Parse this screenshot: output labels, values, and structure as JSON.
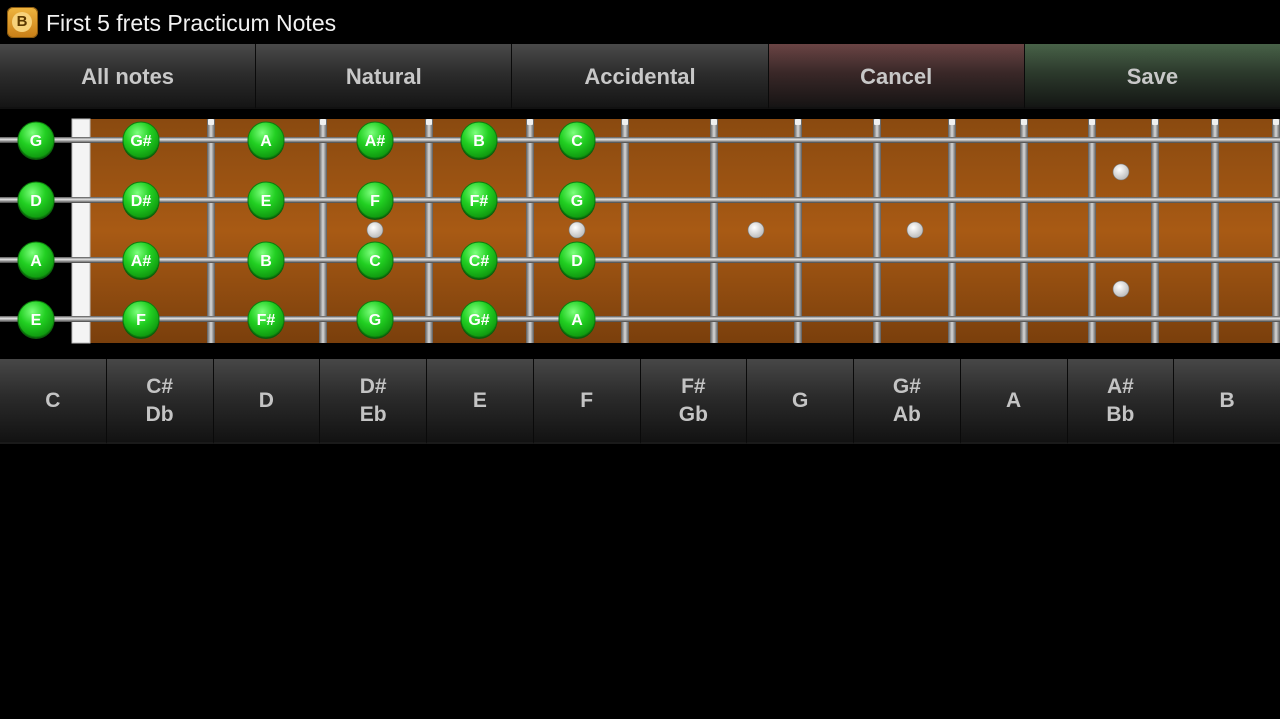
{
  "app": {
    "icon_letter": "B",
    "title": "First 5 frets Practicum Notes"
  },
  "toolbar": {
    "all_notes": "All notes",
    "natural": "Natural",
    "accidental": "Accidental",
    "cancel": "Cancel",
    "save": "Save"
  },
  "fretboard": {
    "strings": [
      {
        "open": "G",
        "frets": [
          "G#",
          "A",
          "A#",
          "B",
          "C"
        ]
      },
      {
        "open": "D",
        "frets": [
          "D#",
          "E",
          "F",
          "F#",
          "G"
        ]
      },
      {
        "open": "A",
        "frets": [
          "A#",
          "B",
          "C",
          "C#",
          "D"
        ]
      },
      {
        "open": "E",
        "frets": [
          "F",
          "F#",
          "G",
          "G#",
          "A"
        ]
      }
    ],
    "note_color": "#22cc22",
    "wood_color": "#a0520f"
  },
  "note_buttons": [
    {
      "line1": "C",
      "line2": ""
    },
    {
      "line1": "C#",
      "line2": "Db"
    },
    {
      "line1": "D",
      "line2": ""
    },
    {
      "line1": "D#",
      "line2": "Eb"
    },
    {
      "line1": "E",
      "line2": ""
    },
    {
      "line1": "F",
      "line2": ""
    },
    {
      "line1": "F#",
      "line2": "Gb"
    },
    {
      "line1": "G",
      "line2": ""
    },
    {
      "line1": "G#",
      "line2": "Ab"
    },
    {
      "line1": "A",
      "line2": ""
    },
    {
      "line1": "A#",
      "line2": "Bb"
    },
    {
      "line1": "B",
      "line2": ""
    }
  ]
}
